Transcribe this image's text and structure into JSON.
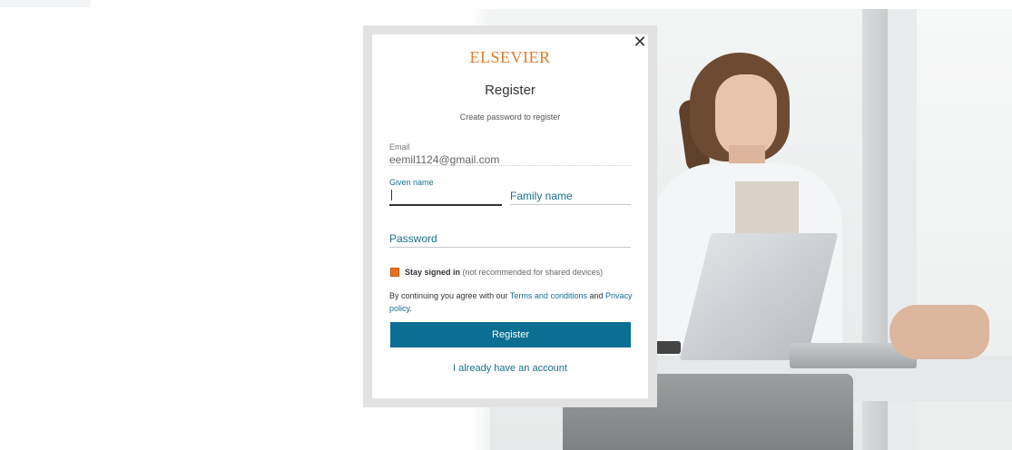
{
  "modal": {
    "close_symbol": "✕",
    "logo": "ELSEVIER",
    "title": "Register",
    "subtitle": "Create password to register"
  },
  "form": {
    "email_label": "Email",
    "email_value": "eemil1124@gmail.com",
    "given_name_label": "Given name",
    "given_name_value": "",
    "family_name_placeholder": "Family name",
    "password_placeholder": "Password",
    "stay_signed_in_label": "Stay signed in",
    "stay_signed_in_note": "(not recommended for shared devices)",
    "stay_signed_in_checked": true
  },
  "terms": {
    "prefix": "By continuing you agree with our ",
    "terms_link": "Terms and conditions",
    "middle": " and ",
    "privacy_link": "Privacy policy",
    "suffix": "."
  },
  "actions": {
    "register_label": "Register",
    "existing_account_label": "I already have an account"
  },
  "colors": {
    "brand_orange": "#e07d2a",
    "primary_blue": "#0b6f94",
    "link_teal": "#1a6f8f"
  }
}
